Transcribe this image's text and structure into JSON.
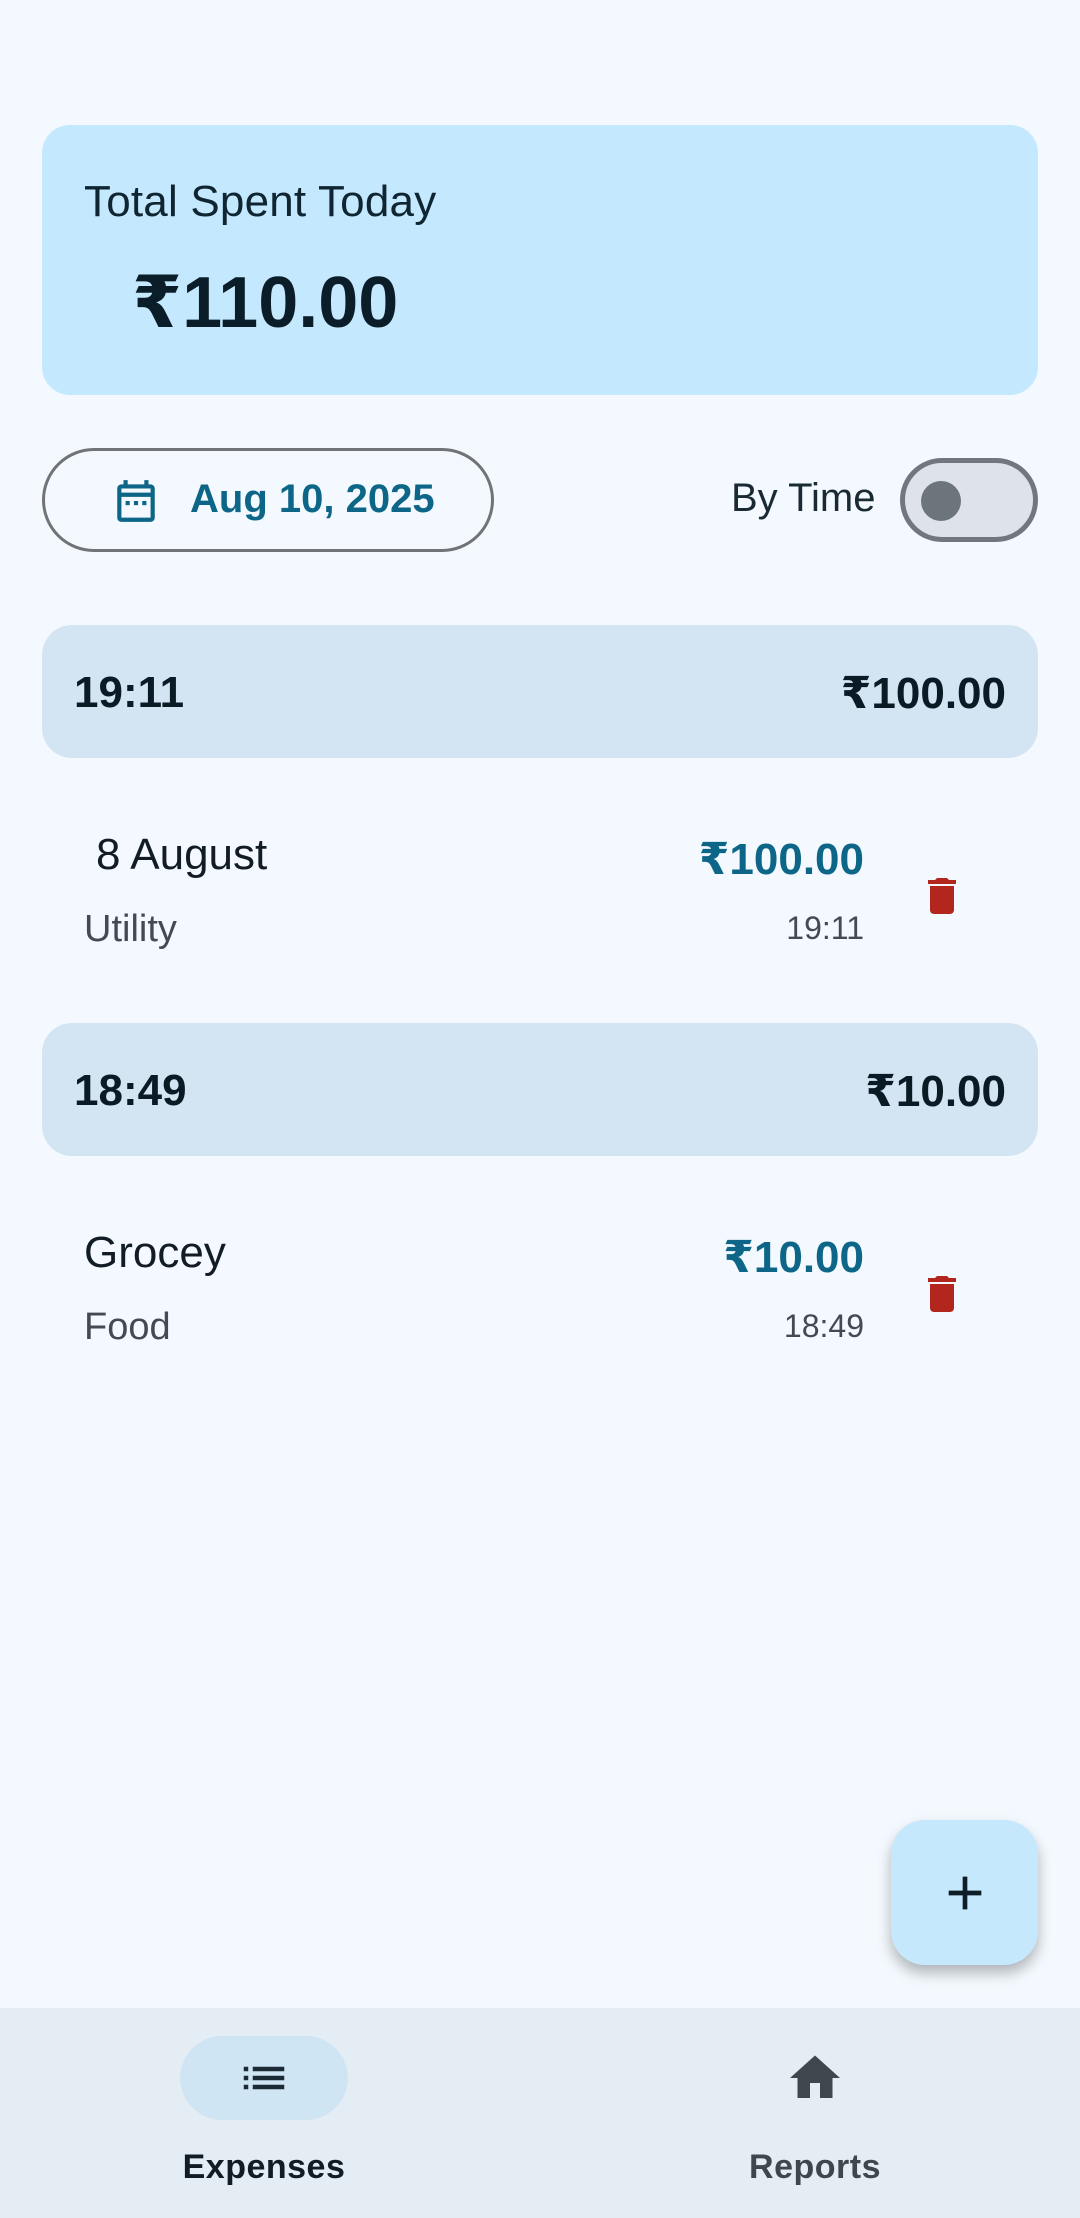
{
  "summary": {
    "label": "Total Spent Today",
    "total": "₹110.00"
  },
  "filter": {
    "date": "Aug 10, 2025",
    "toggle_label": "By Time",
    "toggle_on": false
  },
  "groups": [
    {
      "time": "19:11",
      "total": "₹100.00",
      "items": [
        {
          "title": "8 August",
          "category": "Utility",
          "amount": "₹100.00",
          "time": "19:11"
        }
      ]
    },
    {
      "time": "18:49",
      "total": "₹10.00",
      "items": [
        {
          "title": "Grocey",
          "category": "Food",
          "amount": "₹10.00",
          "time": "18:49"
        }
      ]
    }
  ],
  "nav": {
    "expenses_label": "Expenses",
    "reports_label": "Reports"
  },
  "icons": {
    "calendar": "calendar-icon",
    "delete": "trash-icon",
    "add": "plus-icon",
    "list": "list-icon",
    "home": "home-icon"
  },
  "colors": {
    "accent": "#0d6687",
    "delete": "#b3261e",
    "card": "#c4e8fd",
    "group_header": "#d3e5f3"
  }
}
